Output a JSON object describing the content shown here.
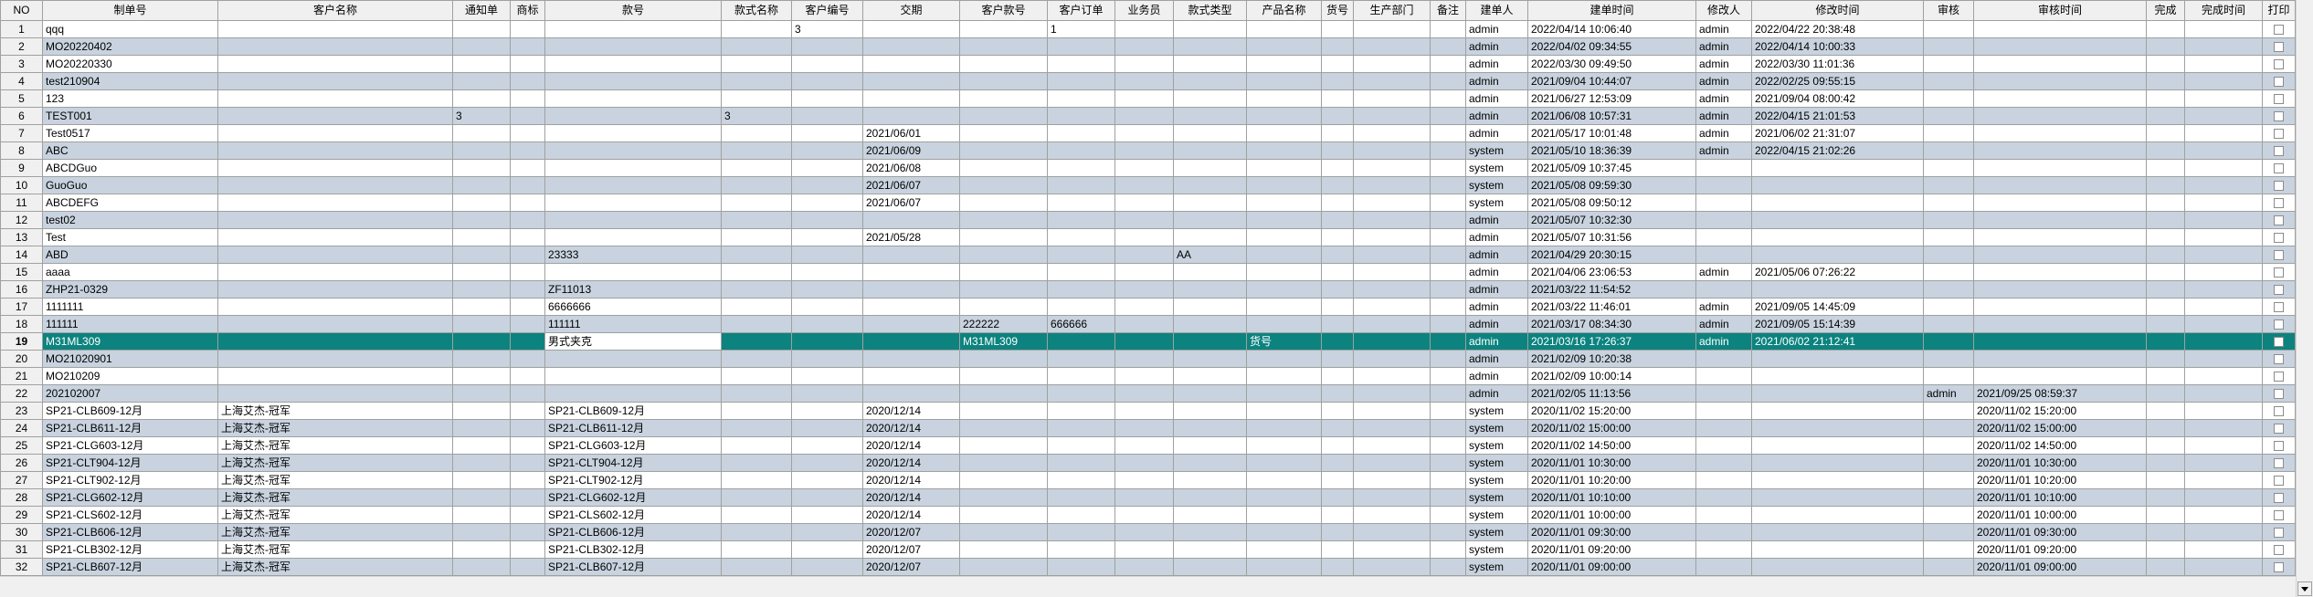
{
  "theme": {
    "header_bg": "#f0f0f0",
    "row_bg": "#ffffff",
    "row_alt_bg": "#c8d3df",
    "grid_line": "#a0a0a0",
    "selected_bg": "#0c837f",
    "selected_text": "#ffffff",
    "text": "#000000"
  },
  "scrollbar": {
    "down_icon": "triangle-down-icon"
  },
  "grid": {
    "selection": {
      "row_no": 19,
      "column_index": 5
    },
    "columns": {
      "no": "NO",
      "order_no": "制单号",
      "customer_name": "客户名称",
      "notice": "通知单",
      "brand": "商标",
      "style_no": "款号",
      "style_name": "款式名称",
      "customer_code": "客户编号",
      "delivery_date": "交期",
      "customer_style_no": "客户款号",
      "customer_order": "客户订单",
      "salesperson": "业务员",
      "style_type": "款式类型",
      "product_name": "产品名称",
      "item_no": "货号",
      "production_dept": "生产部门",
      "remark": "备注",
      "created_by": "建单人",
      "created_at": "建单时间",
      "modified_by": "修改人",
      "modified_at": "修改时间",
      "reviewer": "审核",
      "reviewed_at": "审核时间",
      "completed": "完成",
      "completed_at": "完成时间",
      "print": "打印"
    },
    "rows": [
      {
        "no": "1",
        "order_no": "qqq",
        "customer_code": "3",
        "customer_order": "1",
        "created_by": "admin",
        "created_at": "2022/04/14 10:06:40",
        "modified_by": "admin",
        "modified_at": "2022/04/22 20:38:48",
        "print": false
      },
      {
        "no": "2",
        "order_no": "MO20220402",
        "created_by": "admin",
        "created_at": "2022/04/02 09:34:55",
        "modified_by": "admin",
        "modified_at": "2022/04/14 10:00:33",
        "print": false
      },
      {
        "no": "3",
        "order_no": "MO20220330",
        "created_by": "admin",
        "created_at": "2022/03/30 09:49:50",
        "modified_by": "admin",
        "modified_at": "2022/03/30 11:01:36",
        "print": false
      },
      {
        "no": "4",
        "order_no": "test210904",
        "created_by": "admin",
        "created_at": "2021/09/04 10:44:07",
        "modified_by": "admin",
        "modified_at": "2022/02/25 09:55:15",
        "print": false
      },
      {
        "no": "5",
        "order_no": "123",
        "created_by": "admin",
        "created_at": "2021/06/27 12:53:09",
        "modified_by": "admin",
        "modified_at": "2021/09/04 08:00:42",
        "print": false
      },
      {
        "no": "6",
        "order_no": "TEST001",
        "notice": "3",
        "style_name": "3",
        "created_by": "admin",
        "created_at": "2021/06/08 10:57:31",
        "modified_by": "admin",
        "modified_at": "2022/04/15 21:01:53",
        "print": false
      },
      {
        "no": "7",
        "order_no": "Test0517",
        "delivery_date": "2021/06/01",
        "created_by": "admin",
        "created_at": "2021/05/17 10:01:48",
        "modified_by": "admin",
        "modified_at": "2021/06/02 21:31:07",
        "print": false
      },
      {
        "no": "8",
        "order_no": "ABC",
        "delivery_date": "2021/06/09",
        "created_by": "system",
        "created_at": "2021/05/10 18:36:39",
        "modified_by": "admin",
        "modified_at": "2022/04/15 21:02:26",
        "print": false
      },
      {
        "no": "9",
        "order_no": "ABCDGuo",
        "delivery_date": "2021/06/08",
        "created_by": "system",
        "created_at": "2021/05/09 10:37:45",
        "print": false
      },
      {
        "no": "10",
        "order_no": "GuoGuo",
        "delivery_date": "2021/06/07",
        "created_by": "system",
        "created_at": "2021/05/08 09:59:30",
        "print": false
      },
      {
        "no": "11",
        "order_no": "ABCDEFG",
        "delivery_date": "2021/06/07",
        "created_by": "system",
        "created_at": "2021/05/08 09:50:12",
        "print": false
      },
      {
        "no": "12",
        "order_no": "test02",
        "created_by": "admin",
        "created_at": "2021/05/07 10:32:30",
        "print": false
      },
      {
        "no": "13",
        "order_no": "Test",
        "delivery_date": "2021/05/28",
        "created_by": "admin",
        "created_at": "2021/05/07 10:31:56",
        "print": false
      },
      {
        "no": "14",
        "order_no": "ABD",
        "style_no": "23333",
        "style_type": "AA",
        "created_by": "admin",
        "created_at": "2021/04/29 20:30:15",
        "print": false
      },
      {
        "no": "15",
        "order_no": "aaaa",
        "created_by": "admin",
        "created_at": "2021/04/06 23:06:53",
        "modified_by": "admin",
        "modified_at": "2021/05/06 07:26:22",
        "print": false
      },
      {
        "no": "16",
        "order_no": "ZHP21-0329",
        "style_no": "ZF11013",
        "created_by": "admin",
        "created_at": "2021/03/22 11:54:52",
        "print": false
      },
      {
        "no": "17",
        "order_no": "1111111",
        "style_no": "6666666",
        "created_by": "admin",
        "created_at": "2021/03/22 11:46:01",
        "modified_by": "admin",
        "modified_at": "2021/09/05 14:45:09",
        "print": false
      },
      {
        "no": "18",
        "order_no": "111111",
        "style_no": "111111",
        "customer_style_no": "222222",
        "customer_order": "666666",
        "created_by": "admin",
        "created_at": "2021/03/17 08:34:30",
        "modified_by": "admin",
        "modified_at": "2021/09/05 15:14:39",
        "print": false
      },
      {
        "no": "19",
        "order_no": "M31ML309",
        "style_no": "男式夹克",
        "customer_style_no": "M31ML309",
        "product_name": "货号",
        "created_by": "admin",
        "created_at": "2021/03/16 17:26:37",
        "modified_by": "admin",
        "modified_at": "2021/06/02 21:12:41",
        "print": false
      },
      {
        "no": "20",
        "order_no": "MO21020901",
        "created_by": "admin",
        "created_at": "2021/02/09 10:20:38",
        "print": false
      },
      {
        "no": "21",
        "order_no": "MO210209",
        "created_by": "admin",
        "created_at": "2021/02/09 10:00:14",
        "print": false
      },
      {
        "no": "22",
        "order_no": "202102007",
        "created_by": "admin",
        "created_at": "2021/02/05 11:13:56",
        "reviewer": "admin",
        "reviewed_at": "2021/09/25 08:59:37",
        "print": false
      },
      {
        "no": "23",
        "order_no": "SP21-CLB609-12月",
        "customer_name": "上海艾杰-冠军",
        "style_no": "SP21-CLB609-12月",
        "delivery_date": "2020/12/14",
        "created_by": "system",
        "created_at": "2020/11/02 15:20:00",
        "reviewed_at": "2020/11/02 15:20:00",
        "print": false
      },
      {
        "no": "24",
        "order_no": "SP21-CLB611-12月",
        "customer_name": "上海艾杰-冠军",
        "style_no": "SP21-CLB611-12月",
        "delivery_date": "2020/12/14",
        "created_by": "system",
        "created_at": "2020/11/02 15:00:00",
        "reviewed_at": "2020/11/02 15:00:00",
        "print": false
      },
      {
        "no": "25",
        "order_no": "SP21-CLG603-12月",
        "customer_name": "上海艾杰-冠军",
        "style_no": "SP21-CLG603-12月",
        "delivery_date": "2020/12/14",
        "created_by": "system",
        "created_at": "2020/11/02 14:50:00",
        "reviewed_at": "2020/11/02 14:50:00",
        "print": false
      },
      {
        "no": "26",
        "order_no": "SP21-CLT904-12月",
        "customer_name": "上海艾杰-冠军",
        "style_no": "SP21-CLT904-12月",
        "delivery_date": "2020/12/14",
        "created_by": "system",
        "created_at": "2020/11/01 10:30:00",
        "reviewed_at": "2020/11/01 10:30:00",
        "print": false
      },
      {
        "no": "27",
        "order_no": "SP21-CLT902-12月",
        "customer_name": "上海艾杰-冠军",
        "style_no": "SP21-CLT902-12月",
        "delivery_date": "2020/12/14",
        "created_by": "system",
        "created_at": "2020/11/01 10:20:00",
        "reviewed_at": "2020/11/01 10:20:00",
        "print": false
      },
      {
        "no": "28",
        "order_no": "SP21-CLG602-12月",
        "customer_name": "上海艾杰-冠军",
        "style_no": "SP21-CLG602-12月",
        "delivery_date": "2020/12/14",
        "created_by": "system",
        "created_at": "2020/11/01 10:10:00",
        "reviewed_at": "2020/11/01 10:10:00",
        "print": false
      },
      {
        "no": "29",
        "order_no": "SP21-CLS602-12月",
        "customer_name": "上海艾杰-冠军",
        "style_no": "SP21-CLS602-12月",
        "delivery_date": "2020/12/14",
        "created_by": "system",
        "created_at": "2020/11/01 10:00:00",
        "reviewed_at": "2020/11/01 10:00:00",
        "print": false
      },
      {
        "no": "30",
        "order_no": "SP21-CLB606-12月",
        "customer_name": "上海艾杰-冠军",
        "style_no": "SP21-CLB606-12月",
        "delivery_date": "2020/12/07",
        "created_by": "system",
        "created_at": "2020/11/01 09:30:00",
        "reviewed_at": "2020/11/01 09:30:00",
        "print": false
      },
      {
        "no": "31",
        "order_no": "SP21-CLB302-12月",
        "customer_name": "上海艾杰-冠军",
        "style_no": "SP21-CLB302-12月",
        "delivery_date": "2020/12/07",
        "created_by": "system",
        "created_at": "2020/11/01 09:20:00",
        "reviewed_at": "2020/11/01 09:20:00",
        "print": false
      },
      {
        "no": "32",
        "order_no": "SP21-CLB607-12月",
        "customer_name": "上海艾杰-冠军",
        "style_no": "SP21-CLB607-12月",
        "delivery_date": "2020/12/07",
        "created_by": "system",
        "created_at": "2020/11/01 09:00:00",
        "reviewed_at": "2020/11/01 09:00:00",
        "print": false
      }
    ]
  }
}
